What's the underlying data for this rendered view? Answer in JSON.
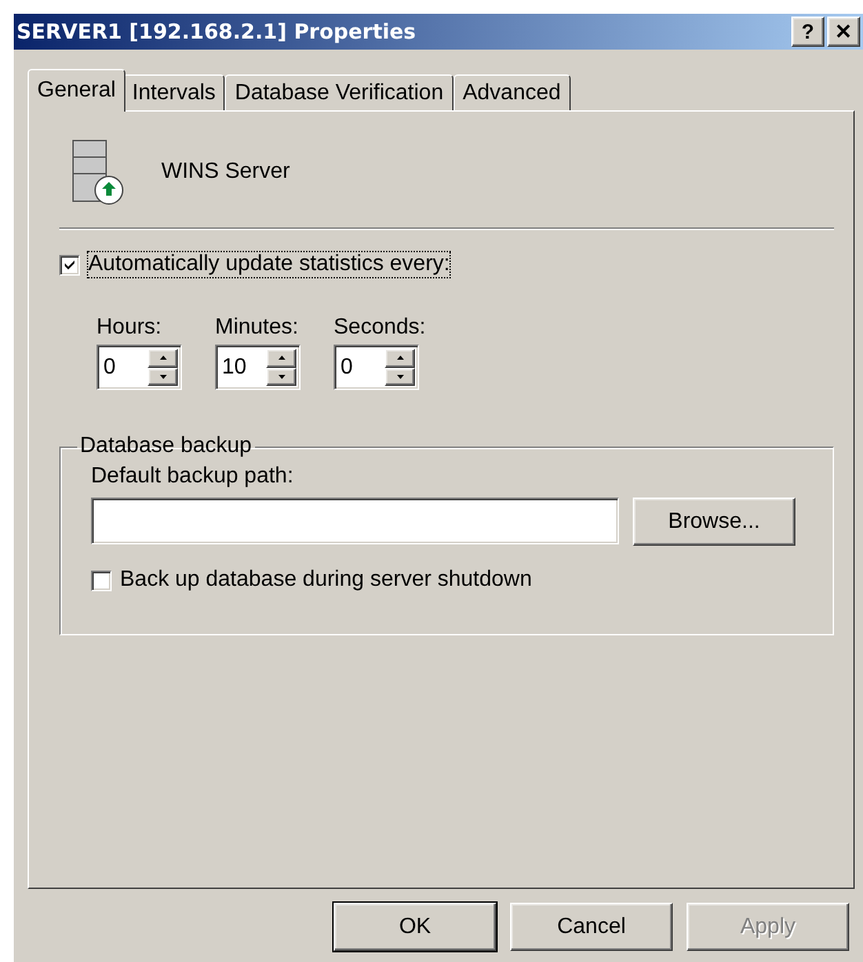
{
  "window": {
    "title": "SERVER1 [192.168.2.1] Properties",
    "help": "?",
    "close": "✕"
  },
  "tabs": [
    {
      "label": "General",
      "selected": true
    },
    {
      "label": "Intervals",
      "selected": false
    },
    {
      "label": "Database Verification",
      "selected": false
    },
    {
      "label": "Advanced",
      "selected": false
    }
  ],
  "server": {
    "name": "WINS Server"
  },
  "auto_update": {
    "label": "Automatically update statistics every:",
    "checked": true
  },
  "spinners": [
    {
      "label": "Hours:",
      "value": "0"
    },
    {
      "label": "Minutes:",
      "value": "10"
    },
    {
      "label": "Seconds:",
      "value": "0"
    }
  ],
  "backup": {
    "title": "Database backup",
    "path_label": "Default backup path:",
    "browse": "Browse...",
    "shutdown": {
      "label": "Back up database during server shutdown",
      "checked": false
    }
  },
  "buttons": [
    {
      "label": "OK",
      "default": true,
      "disabled": false
    },
    {
      "label": "Cancel",
      "default": false,
      "disabled": false
    },
    {
      "label": "Apply",
      "default": false,
      "disabled": true
    }
  ]
}
